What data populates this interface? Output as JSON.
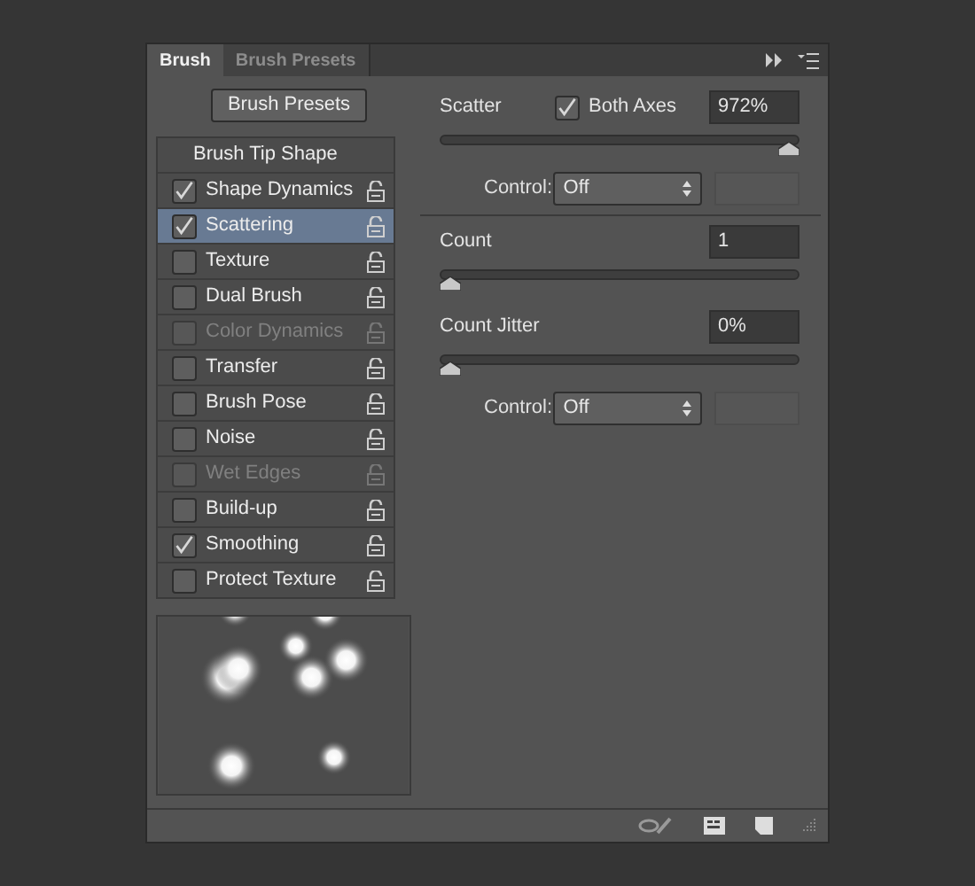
{
  "tabs": [
    {
      "label": "Brush",
      "selected": true
    },
    {
      "label": "Brush Presets",
      "selected": false
    }
  ],
  "presets_button": "Brush Presets",
  "list_header": "Brush Tip Shape",
  "options": [
    {
      "label": "Shape Dynamics",
      "checked": true,
      "disabled": false,
      "selected": false
    },
    {
      "label": "Scattering",
      "checked": true,
      "disabled": false,
      "selected": true
    },
    {
      "label": "Texture",
      "checked": false,
      "disabled": false,
      "selected": false
    },
    {
      "label": "Dual Brush",
      "checked": false,
      "disabled": false,
      "selected": false
    },
    {
      "label": "Color Dynamics",
      "checked": false,
      "disabled": true,
      "selected": false
    },
    {
      "label": "Transfer",
      "checked": false,
      "disabled": false,
      "selected": false
    },
    {
      "label": "Brush Pose",
      "checked": false,
      "disabled": false,
      "selected": false
    },
    {
      "label": "Noise",
      "checked": false,
      "disabled": false,
      "selected": false
    },
    {
      "label": "Wet Edges",
      "checked": false,
      "disabled": true,
      "selected": false
    },
    {
      "label": "Build-up",
      "checked": false,
      "disabled": false,
      "selected": false
    },
    {
      "label": "Smoothing",
      "checked": true,
      "disabled": false,
      "selected": false
    },
    {
      "label": "Protect Texture",
      "checked": false,
      "disabled": false,
      "selected": false
    }
  ],
  "scatter": {
    "label": "Scatter",
    "both_axes": {
      "label": "Both Axes",
      "checked": true
    },
    "value": "972%",
    "level": 1,
    "control": {
      "label": "Control:",
      "value": "Off"
    }
  },
  "count": {
    "label": "Count",
    "value": "1",
    "level": 0
  },
  "count_jitter": {
    "label": "Count Jitter",
    "value": "0%",
    "level": 0,
    "control": {
      "label": "Control:",
      "value": "Off"
    }
  }
}
